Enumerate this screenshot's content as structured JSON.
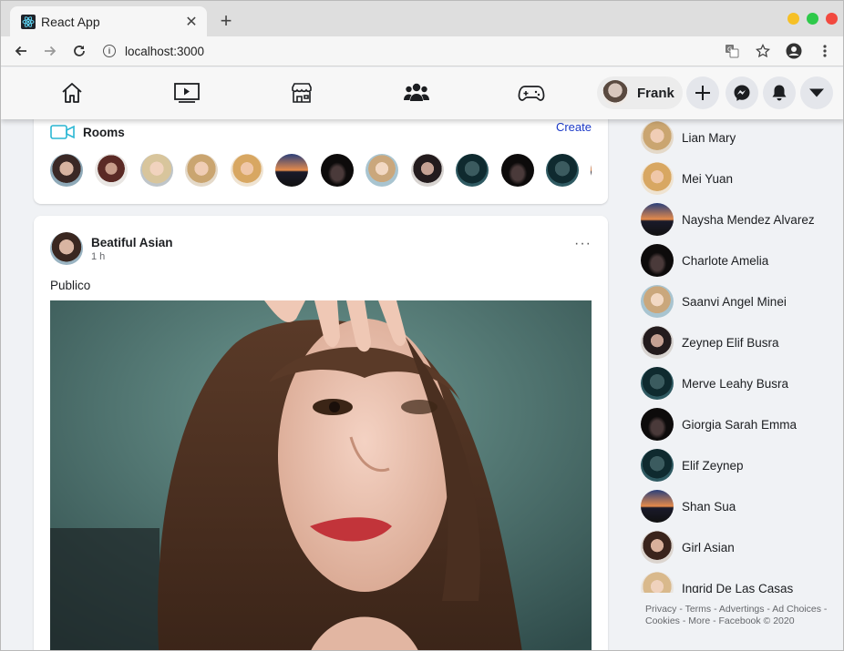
{
  "browser": {
    "tab_title": "React App",
    "tab_close": "✕",
    "new_tab": "+",
    "url": "localhost:3000"
  },
  "header": {
    "nav_icons": [
      "home-icon",
      "watch-icon",
      "marketplace-icon",
      "groups-icon",
      "gaming-icon"
    ],
    "profile_name": "Frank",
    "actions": [
      "create-icon",
      "messenger-icon",
      "notifications-icon",
      "account-menu-icon"
    ],
    "colors": {
      "header_bg": "#f7f7f7",
      "link": "#1b39c8"
    }
  },
  "rooms": {
    "title": "Rooms",
    "create_label": "Create"
  },
  "post": {
    "author": "Beatiful Asian",
    "time": "1 h",
    "more": "···",
    "text": "Publico"
  },
  "contacts": [
    "Lian Mary",
    "Mei Yuan",
    "Naysha Mendez Alvarez",
    "Charlote Amelia",
    "Saanvi Angel Minei",
    "Zeynep Elif Busra",
    "Merve Leahy Busra",
    "Giorgia Sarah Emma",
    "Elif Zeynep",
    "Shan Sua",
    "Girl Asian",
    "Ingrid De Las Casas"
  ],
  "footer": {
    "line1": "Privacy - Terms - Advertings - Ad Choices -",
    "line2": "Cookies - More - Facebook © 2020"
  }
}
